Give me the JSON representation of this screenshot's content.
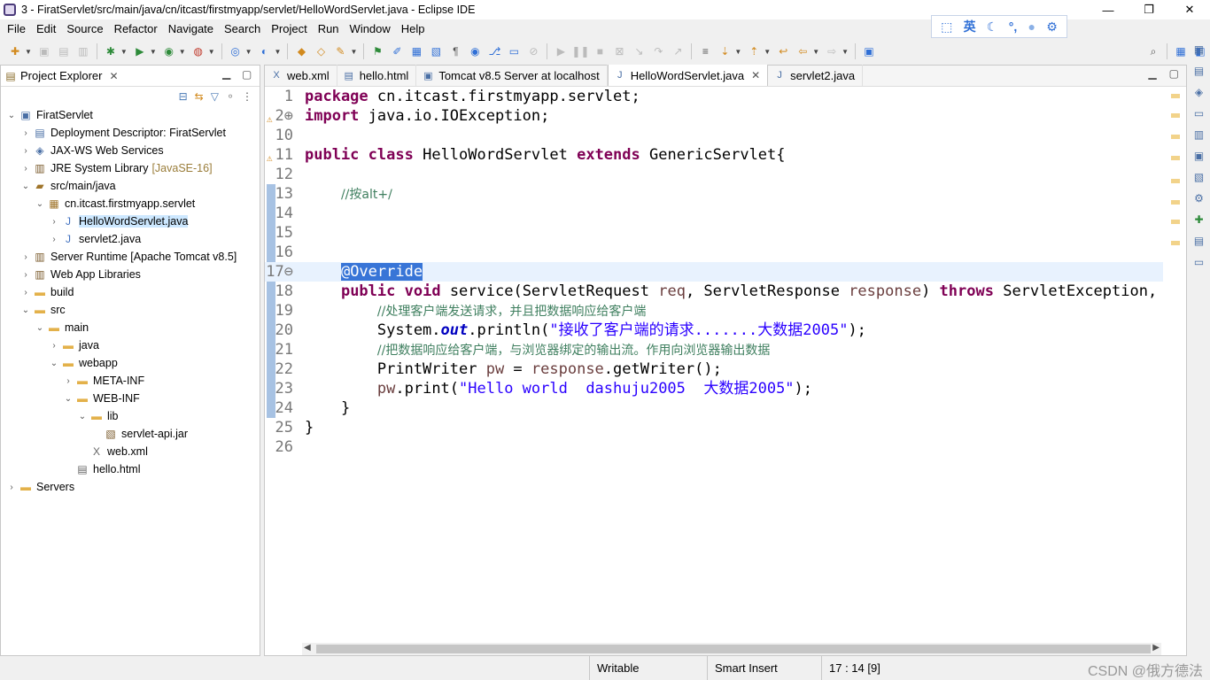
{
  "window": {
    "title": "3 - FiratServlet/src/main/java/cn/itcast/firstmyapp/servlet/HelloWordServlet.java - Eclipse IDE",
    "minimize": "—",
    "restore": "❐",
    "close": "✕"
  },
  "ime": {
    "mode": "英",
    "moon": "☾",
    "dots": "°,",
    "user": "👤",
    "gear": "⚙"
  },
  "menu": [
    "File",
    "Edit",
    "Source",
    "Refactor",
    "Navigate",
    "Search",
    "Project",
    "Run",
    "Window",
    "Help"
  ],
  "explorer": {
    "title": "Project Explorer",
    "close": "✕",
    "tree": [
      {
        "label": "FiratServlet",
        "suffix": "",
        "twisty": "⌄",
        "icon": "project-icon",
        "glyph": "▣"
      },
      {
        "label": "Deployment Descriptor: FiratServlet",
        "suffix": "",
        "twisty": "›",
        "icon": "descriptor-icon",
        "glyph": "▤"
      },
      {
        "label": "JAX-WS Web Services",
        "suffix": "",
        "twisty": "›",
        "icon": "webservices-icon",
        "glyph": "◈"
      },
      {
        "label": "JRE System Library",
        "suffix": "[JavaSE-16]",
        "twisty": "›",
        "icon": "library-icon",
        "glyph": "▥"
      },
      {
        "label": "src/main/java",
        "suffix": "",
        "twisty": "⌄",
        "icon": "source-folder-icon",
        "glyph": "▰"
      },
      {
        "label": "cn.itcast.firstmyapp.servlet",
        "suffix": "",
        "twisty": "⌄",
        "icon": "package-icon",
        "glyph": "▦"
      },
      {
        "label": "HelloWordServlet.java",
        "suffix": "",
        "twisty": "›",
        "icon": "java-file-icon",
        "glyph": "J"
      },
      {
        "label": "servlet2.java",
        "suffix": "",
        "twisty": "›",
        "icon": "java-file-icon",
        "glyph": "J"
      },
      {
        "label": "Server Runtime [Apache Tomcat v8.5]",
        "suffix": "",
        "twisty": "›",
        "icon": "library-icon",
        "glyph": "▥"
      },
      {
        "label": "Web App Libraries",
        "suffix": "",
        "twisty": "›",
        "icon": "library-icon",
        "glyph": "▥"
      },
      {
        "label": "build",
        "suffix": "",
        "twisty": "›",
        "icon": "folder-icon",
        "glyph": "▬"
      },
      {
        "label": "src",
        "suffix": "",
        "twisty": "⌄",
        "icon": "folder-icon",
        "glyph": "▬"
      },
      {
        "label": "main",
        "suffix": "",
        "twisty": "⌄",
        "icon": "folder-icon",
        "glyph": "▬"
      },
      {
        "label": "java",
        "suffix": "",
        "twisty": "›",
        "icon": "folder-icon",
        "glyph": "▬"
      },
      {
        "label": "webapp",
        "suffix": "",
        "twisty": "⌄",
        "icon": "folder-icon",
        "glyph": "▬"
      },
      {
        "label": "META-INF",
        "suffix": "",
        "twisty": "›",
        "icon": "folder-icon",
        "glyph": "▬"
      },
      {
        "label": "WEB-INF",
        "suffix": "",
        "twisty": "⌄",
        "icon": "folder-icon",
        "glyph": "▬"
      },
      {
        "label": "lib",
        "suffix": "",
        "twisty": "⌄",
        "icon": "folder-icon",
        "glyph": "▬"
      },
      {
        "label": "servlet-api.jar",
        "suffix": "",
        "twisty": "",
        "icon": "jar-icon",
        "glyph": "▧"
      },
      {
        "label": "web.xml",
        "suffix": "",
        "twisty": "",
        "icon": "xml-file-icon",
        "glyph": "X"
      },
      {
        "label": "hello.html",
        "suffix": "",
        "twisty": "",
        "icon": "html-file-icon",
        "glyph": "▤"
      },
      {
        "label": "Servers",
        "suffix": "",
        "twisty": "›",
        "icon": "folder-icon",
        "glyph": "▬"
      }
    ]
  },
  "tabs": [
    {
      "label": "web.xml",
      "glyph": "X",
      "active": false
    },
    {
      "label": "hello.html",
      "glyph": "▤",
      "active": false
    },
    {
      "label": "Tomcat v8.5 Server at localhost",
      "glyph": "▣",
      "active": false
    },
    {
      "label": "HelloWordServlet.java",
      "glyph": "J",
      "active": true
    },
    {
      "label": "servlet2.java",
      "glyph": "J",
      "active": false
    }
  ],
  "tab_close": "✕",
  "code_lines": [
    {
      "n": "1",
      "text": "package cn.itcast.firstmyapp.servlet;"
    },
    {
      "n": "2⊕",
      "text": "import java.io.IOException;"
    },
    {
      "n": "10",
      "text": ""
    },
    {
      "n": "11",
      "text": "public class HelloWordServlet extends GenericServlet{"
    },
    {
      "n": "12",
      "text": ""
    },
    {
      "n": "13",
      "text": "    //按alt+/"
    },
    {
      "n": "14",
      "text": ""
    },
    {
      "n": "15",
      "text": ""
    },
    {
      "n": "16",
      "text": ""
    },
    {
      "n": "17⊖",
      "text": "    @Override"
    },
    {
      "n": "18",
      "text": "    public void service(ServletRequest req, ServletResponse response) throws ServletException, IO"
    },
    {
      "n": "19",
      "text": "        //处理客户端发送请求，并且把数据响应给客户端"
    },
    {
      "n": "20",
      "text": "        System.out.println(\"接收了客户端的请求.......大数据2005\");"
    },
    {
      "n": "21",
      "text": "        //把数据响应给客户端，与浏览器绑定的输出流。作用向浏览器输出数据"
    },
    {
      "n": "22",
      "text": "        PrintWriter pw = response.getWriter();"
    },
    {
      "n": "23",
      "text": "        pw.print(\"Hello world  dashuju2005  大数据2005\");"
    },
    {
      "n": "24",
      "text": "    }"
    },
    {
      "n": "25",
      "text": "}"
    },
    {
      "n": "26",
      "text": ""
    }
  ],
  "status": {
    "writable": "Writable",
    "insert_mode": "Smart Insert",
    "position": "17 : 14 [9]"
  },
  "watermark": "CSDN @俄方德法",
  "colors": {
    "keyword": "#7f0055",
    "comment": "#3f7f5f",
    "string": "#2a00ff",
    "selection": "#3875d7",
    "current_line": "#e8f2fe"
  }
}
